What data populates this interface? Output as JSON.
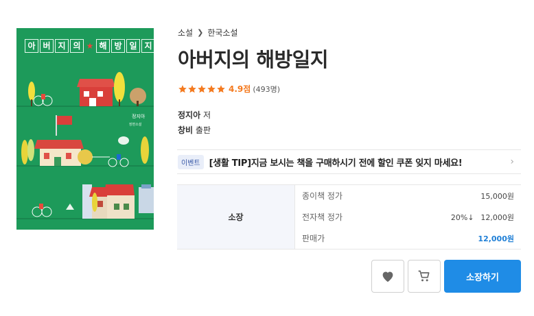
{
  "cover": {
    "title_chars": [
      "아",
      "버",
      "지",
      "의",
      "★",
      "해",
      "방",
      "일",
      "지"
    ],
    "author": "정지아",
    "subtitle": "장편소설"
  },
  "breadcrumb": {
    "category": "소설",
    "subcategory": "한국소설"
  },
  "book": {
    "title": "아버지의 해방일지",
    "rating_score": "4.9점",
    "rating_count": "(493명)",
    "stars_filled": 5,
    "author_name": "정지아",
    "author_role": "저",
    "publisher_name": "창비",
    "publisher_role": "출판"
  },
  "event": {
    "badge": "이벤트",
    "text": "[생활 TIP]지금 보시는 책을 구매하시기 전에 할인 쿠폰 잊지 마세요!"
  },
  "price": {
    "head": "소장",
    "rows": [
      {
        "label": "종이책 정가",
        "value": "15,000원",
        "discount": ""
      },
      {
        "label": "전자책 정가",
        "value": "12,000원",
        "discount": "20%↓"
      },
      {
        "label": "판매가",
        "value": "12,000원",
        "discount": ""
      }
    ]
  },
  "actions": {
    "wish_icon": "heart-icon",
    "cart_icon": "cart-icon",
    "buy_label": "소장하기"
  },
  "colors": {
    "accent": "#1f8ce6",
    "rating": "#f47a1f",
    "cover_bg": "#1d9a5a"
  }
}
